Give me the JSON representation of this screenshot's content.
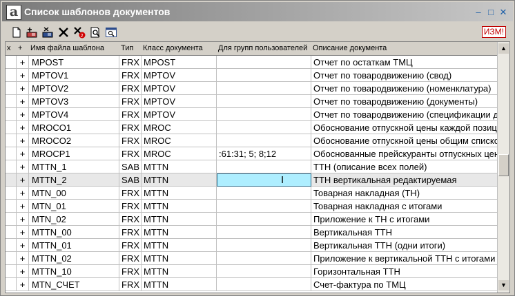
{
  "window": {
    "title": "Список шаблонов документов",
    "controls": {
      "minimize": "–",
      "maximize": "□",
      "close": "✕"
    }
  },
  "toolbar": {
    "buttons": [
      "new-doc-icon",
      "insert-record-icon",
      "copy-record-icon",
      "delete-icon",
      "delete-all-icon",
      "preview-icon",
      "find-icon"
    ],
    "mode_badge": "ИЗМ!"
  },
  "table": {
    "columns": [
      "х",
      "+",
      "Имя файла шаблона",
      "Тип",
      "Класс документа",
      "Для групп пользователей",
      "Описание документа"
    ],
    "rows": [
      {
        "plus": "+",
        "name": "MPOST",
        "type": "FRX",
        "class": "MPOST",
        "groups": "",
        "desc": "Отчет по остаткам ТМЦ"
      },
      {
        "plus": "+",
        "name": "MPTOV1",
        "type": "FRX",
        "class": "MPTOV",
        "groups": "",
        "desc": "Отчет по товародвижению (свод)"
      },
      {
        "plus": "+",
        "name": "MPTOV2",
        "type": "FRX",
        "class": "MPTOV",
        "groups": "",
        "desc": "Отчет по товародвижению (номенклатура)"
      },
      {
        "plus": "+",
        "name": "MPTOV3",
        "type": "FRX",
        "class": "MPTOV",
        "groups": "",
        "desc": "Отчет по товародвижению (документы)"
      },
      {
        "plus": "+",
        "name": "MPTOV4",
        "type": "FRX",
        "class": "MPTOV",
        "groups": "",
        "desc": "Отчет по товародвижению (спецификации до"
      },
      {
        "plus": "+",
        "name": "MROCO1",
        "type": "FRX",
        "class": "MROC",
        "groups": "",
        "desc": "Обоснование отпускной цены каждой позиц"
      },
      {
        "plus": "+",
        "name": "MROCO2",
        "type": "FRX",
        "class": "MROC",
        "groups": "",
        "desc": "Обоснование отпускной цены общим списко"
      },
      {
        "plus": "+",
        "name": "MROCP1",
        "type": "FRX",
        "class": "MROC",
        "groups": ":61:31; 5; 8;12",
        "desc": "Обоснованные прейскуранты отпускных цен"
      },
      {
        "plus": "+",
        "name": "MTTN_1",
        "type": "SAB",
        "class": "MTTN",
        "groups": "",
        "desc": "ТТН (описание всех полей)"
      },
      {
        "plus": "+",
        "name": "MTTN_2",
        "type": "SAB",
        "class": "MTTN",
        "groups": "",
        "desc": "ТТН вертикальная редактируемая",
        "selected": true
      },
      {
        "plus": "+",
        "name": "MTN_00",
        "type": "FRX",
        "class": "MTTN",
        "groups": "",
        "desc": "Товарная накладная (ТН)"
      },
      {
        "plus": "+",
        "name": "MTN_01",
        "type": "FRX",
        "class": "MTTN",
        "groups": "",
        "desc": "Товарная накладная с итогами"
      },
      {
        "plus": "+",
        "name": "MTN_02",
        "type": "FRX",
        "class": "MTTN",
        "groups": "",
        "desc": "Приложение к ТН с итогами"
      },
      {
        "plus": "+",
        "name": "MTTN_00",
        "type": "FRX",
        "class": "MTTN",
        "groups": "",
        "desc": "Вертикальная ТТН"
      },
      {
        "plus": "+",
        "name": "MTTN_01",
        "type": "FRX",
        "class": "MTTN",
        "groups": "",
        "desc": "Вертикальная ТТН  (одни итоги)"
      },
      {
        "plus": "+",
        "name": "MTTN_02",
        "type": "FRX",
        "class": "MTTN",
        "groups": "",
        "desc": "Приложение к вертикальной ТТН с итогами"
      },
      {
        "plus": "+",
        "name": "MTTN_10",
        "type": "FRX",
        "class": "MTTN",
        "groups": "",
        "desc": "Горизонтальная ТТН"
      },
      {
        "plus": "+",
        "name": "MTN_СЧЕТ",
        "type": "FRX",
        "class": "MTTN",
        "groups": "",
        "desc": "Счет-фактура по ТМЦ"
      }
    ]
  },
  "scrollbar": {
    "up": "▲",
    "down": "▼"
  },
  "colors": {
    "title_gradient_start": "#7a7a7a",
    "edit_cell": "#aeeeff",
    "mode_badge": "#c00000"
  }
}
